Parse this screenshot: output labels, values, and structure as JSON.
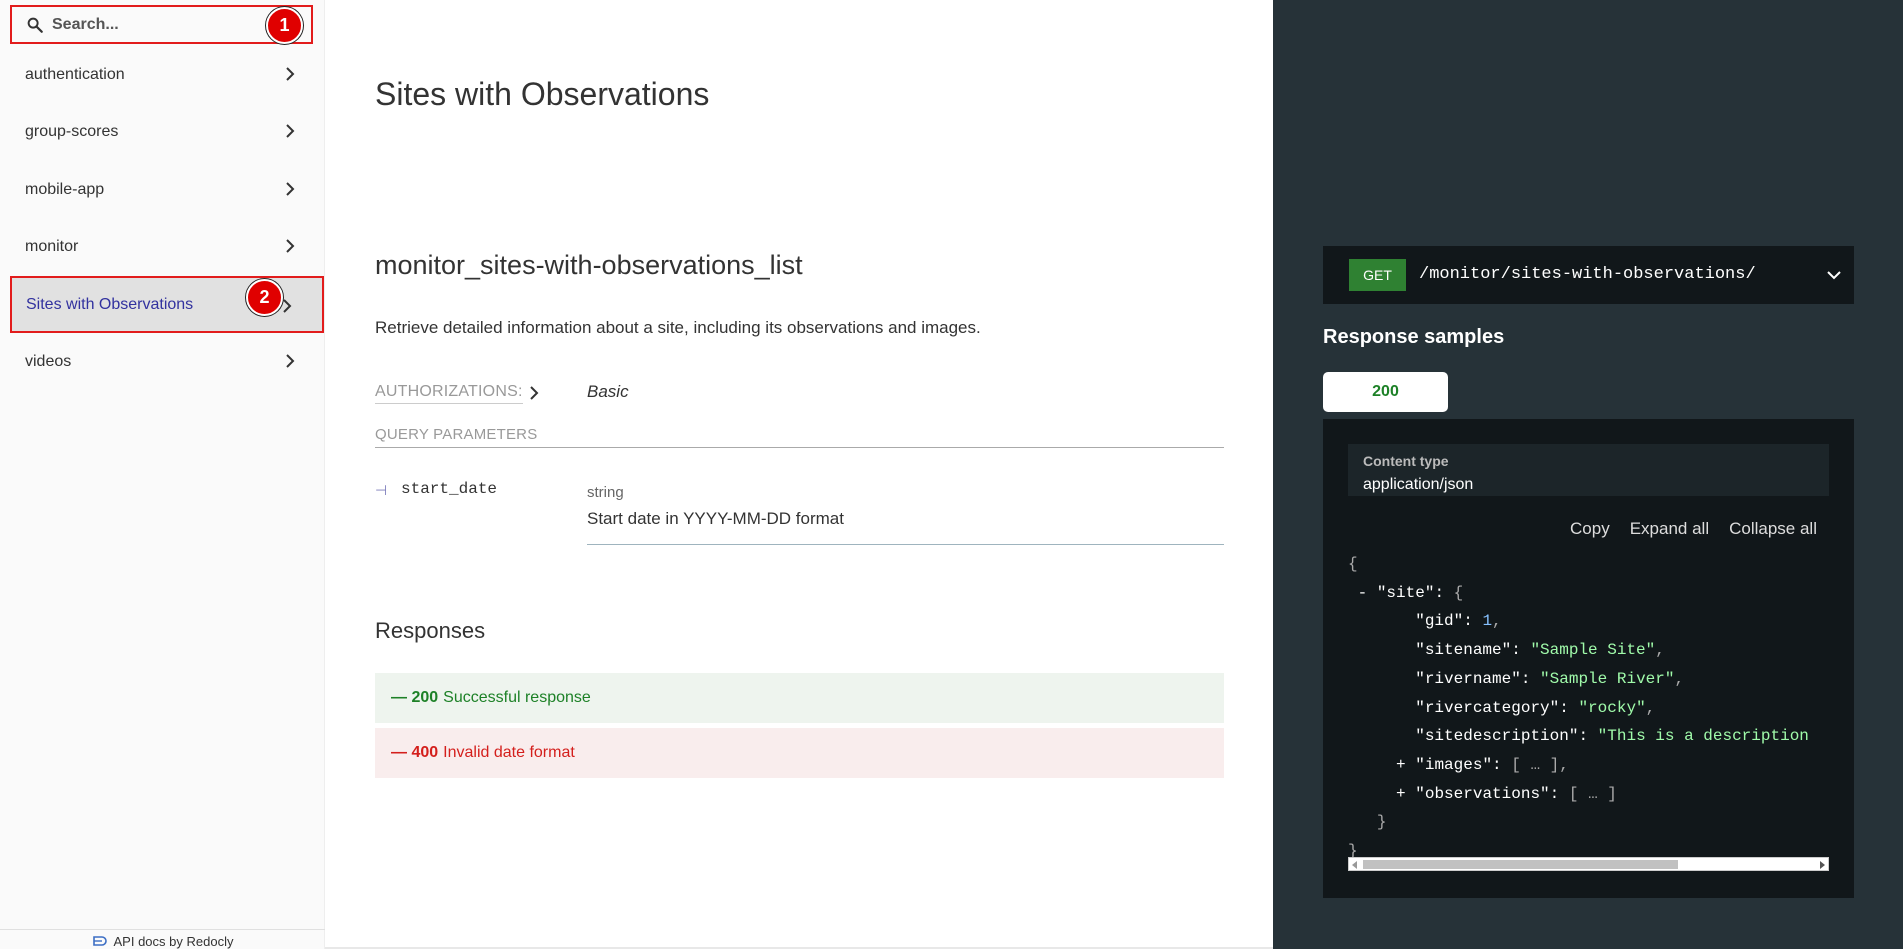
{
  "sidebar": {
    "search_placeholder": "Search...",
    "items": [
      {
        "label": "authentication"
      },
      {
        "label": "group-scores"
      },
      {
        "label": "mobile-app"
      },
      {
        "label": "monitor"
      },
      {
        "label": "Sites with Observations"
      },
      {
        "label": "videos"
      }
    ],
    "footer": "API docs by Redocly"
  },
  "markers": [
    "1",
    "2"
  ],
  "main": {
    "page_title": "Sites with Observations",
    "operation_title": "monitor_sites-with-observations_list",
    "description": "Retrieve detailed information about a site, including its observations and images.",
    "authorizations_label": "AUTHORIZATIONS:",
    "authorizations_value": "Basic",
    "query_parameters_label": "QUERY PARAMETERS",
    "params": [
      {
        "name": "start_date",
        "type": "string",
        "description": "Start date in YYYY-MM-DD format"
      }
    ],
    "responses_title": "Responses",
    "responses": [
      {
        "code": "200",
        "label": "Successful response"
      },
      {
        "code": "400",
        "label": "Invalid date format"
      }
    ]
  },
  "right": {
    "method": "GET",
    "path": "/monitor/sites-with-observations/",
    "samples_title": "Response samples",
    "status_tab": "200",
    "content_type_label": "Content type",
    "content_type_value": "application/json",
    "actions": {
      "copy": "Copy",
      "expand": "Expand all",
      "collapse": "Collapse all"
    },
    "json": {
      "key_site": "\"site\"",
      "gid_key": "\"gid\"",
      "gid_val": "1",
      "sitename_key": "\"sitename\"",
      "sitename_val": "\"Sample Site\"",
      "rivername_key": "\"rivername\"",
      "rivername_val": "\"Sample River\"",
      "rivercategory_key": "\"rivercategory\"",
      "rivercategory_val": "\"rocky\"",
      "sitedescription_key": "\"sitedescription\"",
      "sitedescription_val": "\"This is a description",
      "images_key": "\"images\"",
      "observations_key": "\"observations\""
    }
  },
  "colors": {
    "accent": "#32329f",
    "success": "#1d8127",
    "error": "#d41f1c",
    "marker": "#e00000",
    "right_panel": "#263238"
  }
}
